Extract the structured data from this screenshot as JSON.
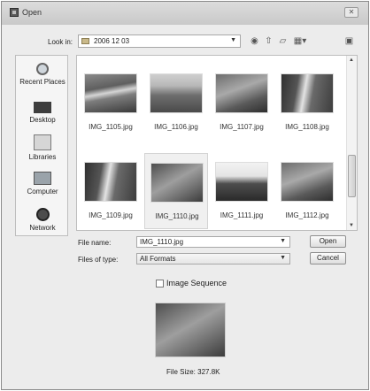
{
  "window": {
    "title": "Open",
    "close_glyph": "✕"
  },
  "look_in": {
    "label": "Look in:",
    "value": "2006 12 03"
  },
  "places": [
    {
      "label": "Recent Places",
      "icon": "recent-places-icon"
    },
    {
      "label": "Desktop",
      "icon": "desktop-icon"
    },
    {
      "label": "Libraries",
      "icon": "libraries-icon"
    },
    {
      "label": "Computer",
      "icon": "computer-icon"
    },
    {
      "label": "Network",
      "icon": "network-icon"
    }
  ],
  "files": [
    {
      "name": "IMG_1105.jpg",
      "selected": false
    },
    {
      "name": "IMG_1106.jpg",
      "selected": false
    },
    {
      "name": "IMG_1107.jpg",
      "selected": false
    },
    {
      "name": "IMG_1108.jpg",
      "selected": false
    },
    {
      "name": "IMG_1109.jpg",
      "selected": false
    },
    {
      "name": "IMG_1110.jpg",
      "selected": true
    },
    {
      "name": "IMG_1111.jpg",
      "selected": false
    },
    {
      "name": "IMG_1112.jpg",
      "selected": false
    }
  ],
  "file_name": {
    "label": "File name:",
    "value": "IMG_1110.jpg"
  },
  "file_type": {
    "label": "Files of type:",
    "value": "All Formats"
  },
  "buttons": {
    "open": "Open",
    "cancel": "Cancel"
  },
  "image_sequence": {
    "label": "Image Sequence",
    "checked": false
  },
  "preview": {
    "file_size": "File Size: 327.8K"
  }
}
